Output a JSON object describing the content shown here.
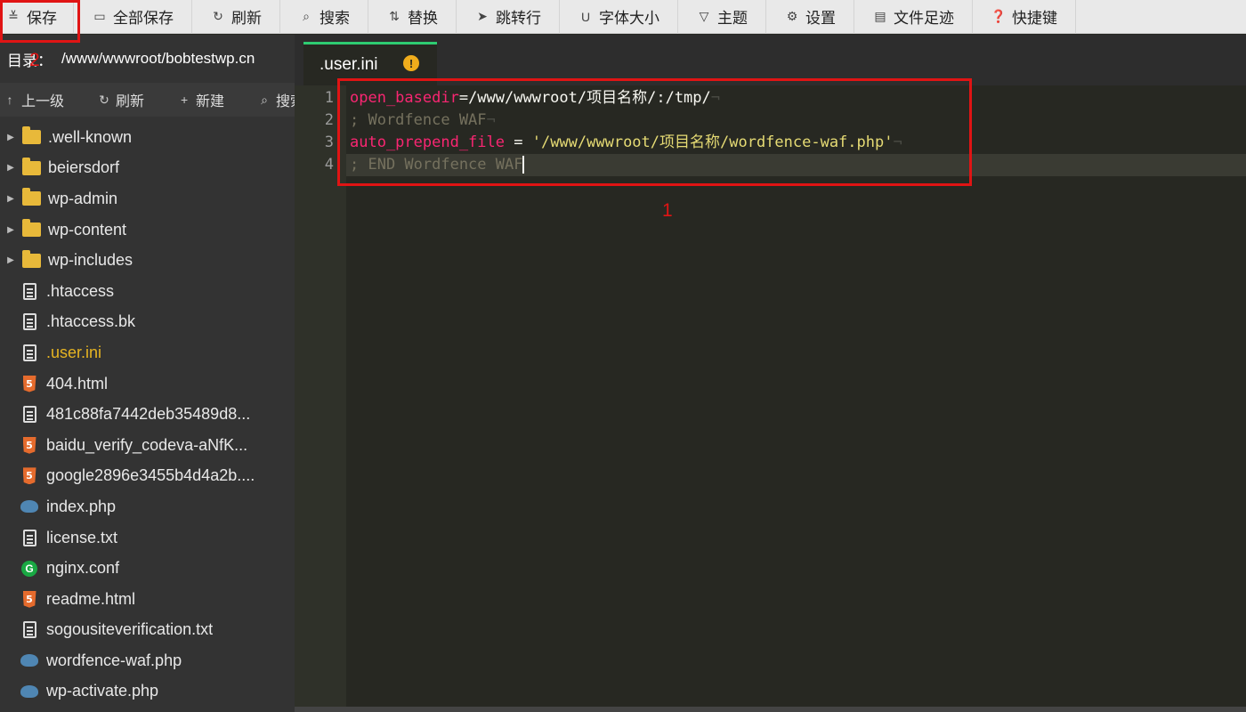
{
  "toolbar": {
    "items": [
      {
        "label": "保存",
        "icon": "save-icon"
      },
      {
        "label": "全部保存",
        "icon": "save-all-icon"
      },
      {
        "label": "刷新",
        "icon": "refresh-icon"
      },
      {
        "label": "搜索",
        "icon": "search-icon"
      },
      {
        "label": "替换",
        "icon": "replace-icon"
      },
      {
        "label": "跳转行",
        "icon": "goto-line-icon"
      },
      {
        "label": "字体大小",
        "icon": "font-size-icon"
      },
      {
        "label": "主题",
        "icon": "theme-icon"
      },
      {
        "label": "设置",
        "icon": "settings-icon"
      },
      {
        "label": "文件足迹",
        "icon": "history-icon"
      },
      {
        "label": "快捷键",
        "icon": "help-icon"
      }
    ]
  },
  "sidebar": {
    "dir_label": "目录：",
    "dir_path": "/www/wwwroot/bobtestwp.cn",
    "actions": [
      {
        "label": "上一级",
        "icon": "up-arrow-icon"
      },
      {
        "label": "刷新",
        "icon": "refresh-icon"
      },
      {
        "label": "新建",
        "icon": "plus-icon"
      },
      {
        "label": "搜索",
        "icon": "search-icon"
      }
    ],
    "files": [
      {
        "name": ".well-known",
        "type": "folder"
      },
      {
        "name": "beiersdorf",
        "type": "folder"
      },
      {
        "name": "wp-admin",
        "type": "folder"
      },
      {
        "name": "wp-content",
        "type": "folder"
      },
      {
        "name": "wp-includes",
        "type": "folder"
      },
      {
        "name": ".htaccess",
        "type": "text"
      },
      {
        "name": ".htaccess.bk",
        "type": "text"
      },
      {
        "name": ".user.ini",
        "type": "text",
        "active": true
      },
      {
        "name": "404.html",
        "type": "html"
      },
      {
        "name": "481c88fa7442deb35489d8...",
        "type": "text"
      },
      {
        "name": "baidu_verify_codeva-aNfK...",
        "type": "html"
      },
      {
        "name": "google2896e3455b4d4a2b....",
        "type": "html"
      },
      {
        "name": "index.php",
        "type": "php"
      },
      {
        "name": "license.txt",
        "type": "text"
      },
      {
        "name": "nginx.conf",
        "type": "nginx"
      },
      {
        "name": "readme.html",
        "type": "html"
      },
      {
        "name": "sogousiteverification.txt",
        "type": "text"
      },
      {
        "name": "wordfence-waf.php",
        "type": "php"
      },
      {
        "name": "wp-activate.php",
        "type": "php"
      }
    ]
  },
  "editor": {
    "tab_label": ".user.ini",
    "tab_warning": "!",
    "collapse_glyph": "‹",
    "lines": [
      {
        "num": "1",
        "segments": [
          [
            "kw",
            "open_basedir"
          ],
          [
            "plain",
            "=/www/wwwroot/项目名称/:/tmp/"
          ],
          [
            "ws",
            "¬"
          ]
        ]
      },
      {
        "num": "2",
        "segments": [
          [
            "cmt",
            "; Wordfence WAF"
          ],
          [
            "ws",
            "¬"
          ]
        ]
      },
      {
        "num": "3",
        "segments": [
          [
            "kw",
            "auto_prepend_file"
          ],
          [
            "plain",
            " = "
          ],
          [
            "str",
            "'/www/wwwroot/项目名称/wordfence-waf.php'"
          ],
          [
            "ws",
            "¬"
          ]
        ]
      },
      {
        "num": "4",
        "segments": [
          [
            "cmt",
            "; END Wordfence WAF"
          ]
        ],
        "current": true
      }
    ]
  },
  "annotations": {
    "one": "1",
    "two": "2"
  },
  "colors": {
    "accent_tab": "#2ecc71",
    "annotation_red": "#e01414",
    "active_file": "#e6b422"
  }
}
